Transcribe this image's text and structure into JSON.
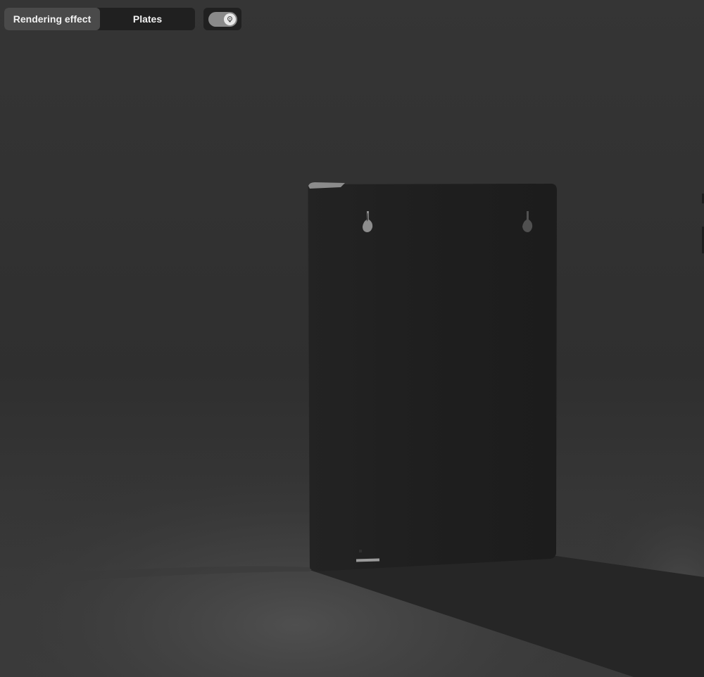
{
  "toolbar": {
    "tabs": [
      {
        "label": "Rendering effect",
        "active": true
      },
      {
        "label": "Plates",
        "active": false
      }
    ],
    "light_toggle": {
      "on": true,
      "icon": "lightbulb-icon"
    }
  },
  "scene": {
    "object": "dark rectangular plate with two keyhole mounting slots",
    "colors": {
      "background": "#303030",
      "plate": "#1f1f1f",
      "shadow": "#262626",
      "floor_glow": "#4a4a4a"
    }
  }
}
